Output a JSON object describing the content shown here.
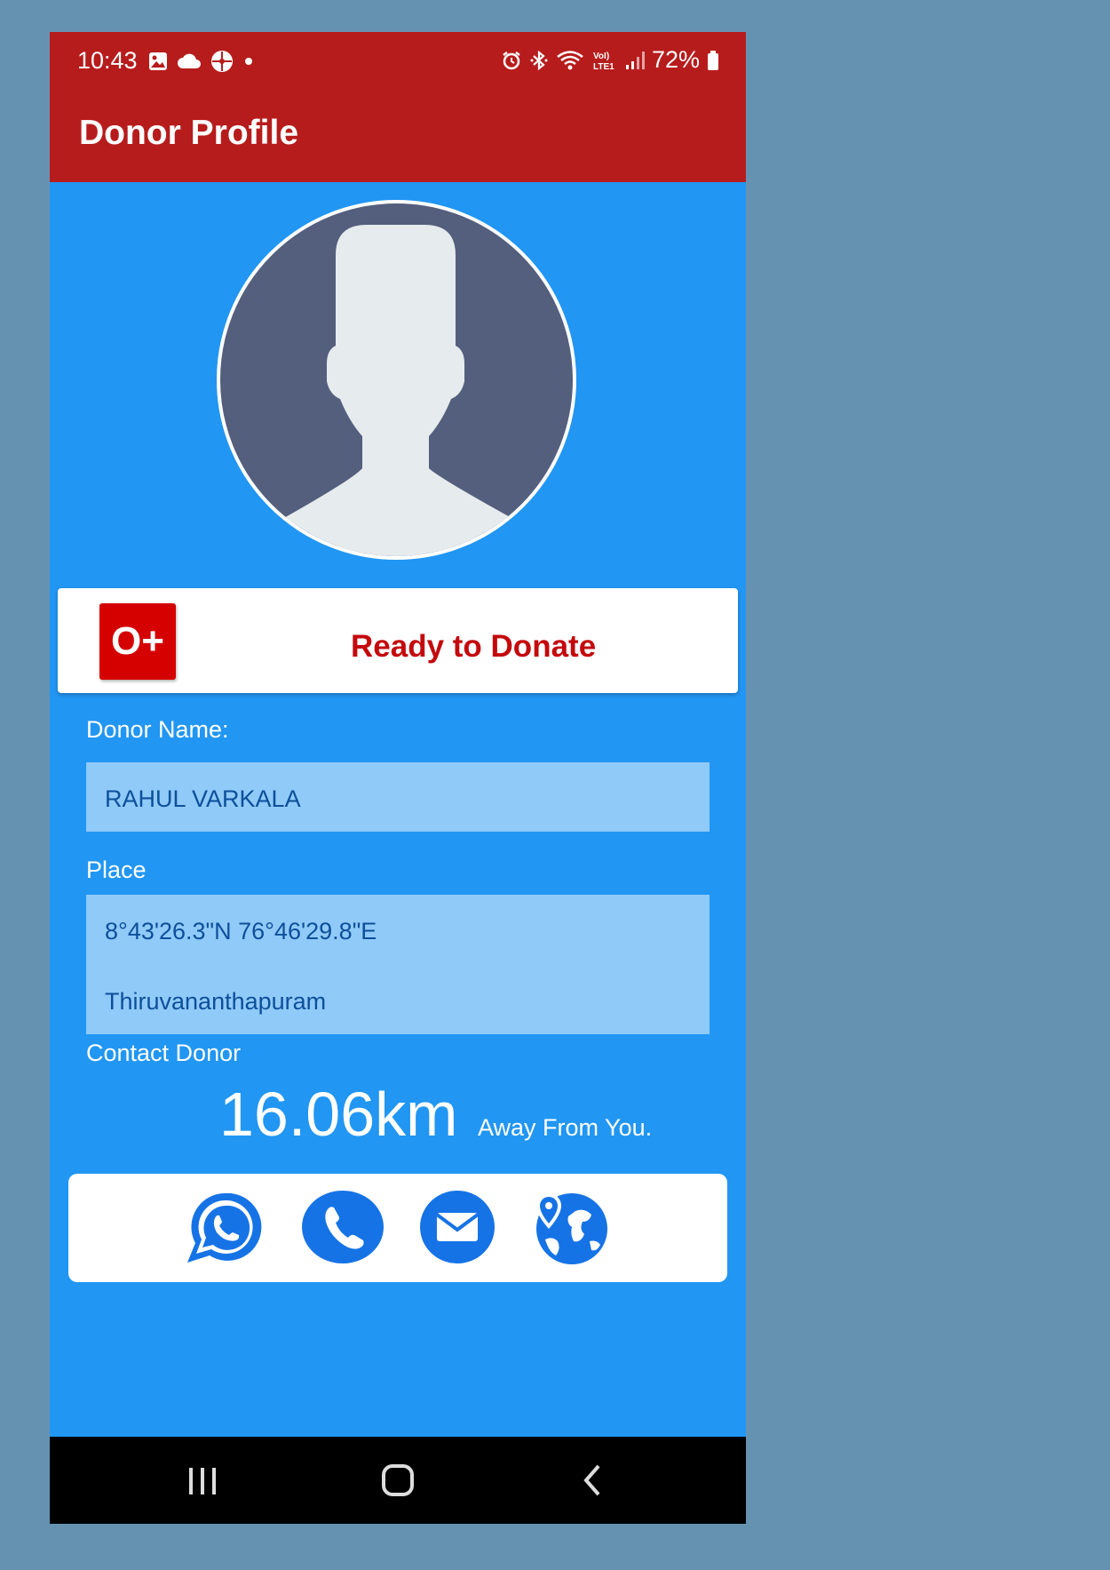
{
  "status_bar": {
    "time": "10:43",
    "battery": "72%",
    "left_icons": [
      "image-icon",
      "cloud-icon",
      "app-icon",
      "notification-dot-icon"
    ],
    "right_icons": [
      "alarm-icon",
      "bluetooth-icon",
      "wifi-icon",
      "volte-icon",
      "signal-icon",
      "battery-icon"
    ],
    "volte_label": "VoLTE1"
  },
  "app_bar": {
    "title": "Donor Profile"
  },
  "profile": {
    "avatar_icon": "default-user-avatar-icon"
  },
  "donor_status": {
    "blood_group": "O+",
    "status_text": "Ready to Donate"
  },
  "donor_name": {
    "label": "Donor Name:",
    "value": "RAHUL VARKALA"
  },
  "place": {
    "label": "Place",
    "coordinates": "8°43'26.3\"N 76°46'29.8\"E",
    "city": "Thiruvananthapuram"
  },
  "contact": {
    "label": "Contact Donor",
    "distance": "16.06km",
    "distance_suffix": "Away From You.",
    "actions": [
      "whatsapp-icon",
      "phone-icon",
      "email-icon",
      "map-location-icon"
    ]
  },
  "navigation_bar": {
    "buttons": [
      "recent-apps-icon",
      "home-icon",
      "back-icon"
    ]
  },
  "colors": {
    "app_bar": "#b71c1c",
    "content_background": "#2196f3",
    "field_background": "#90caf9",
    "field_text": "#0d4f9a",
    "accent_red": "#d50000",
    "contact_icon": "#1673e6",
    "page_background": "#6692b2"
  }
}
